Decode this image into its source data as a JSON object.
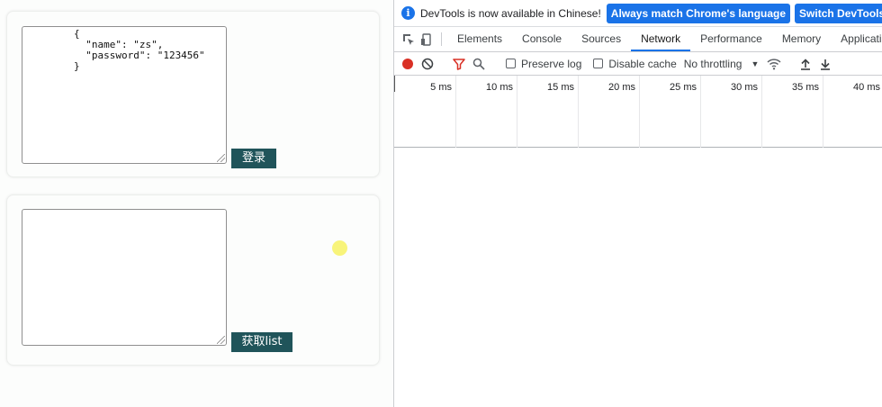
{
  "login_card": {
    "textarea_value": "        {\n          \"name\": \"zs\",\n          \"password\": \"123456\"\n        }",
    "button_label": "登录"
  },
  "list_card": {
    "textarea_value": "",
    "button_label": "获取list"
  },
  "devtools": {
    "infobar": {
      "message": "DevTools is now available in Chinese!",
      "match_language_button": "Always match Chrome's language",
      "switch_button": "Switch DevTools to Chinese"
    },
    "tabs": [
      {
        "label": "Elements"
      },
      {
        "label": "Console"
      },
      {
        "label": "Sources"
      },
      {
        "label": "Network",
        "active": true
      },
      {
        "label": "Performance"
      },
      {
        "label": "Memory"
      },
      {
        "label": "Application"
      }
    ],
    "network_toolbar": {
      "preserve_log_label": "Preserve log",
      "disable_cache_label": "Disable cache",
      "throttling_value": "No throttling"
    },
    "timeline_ticks": [
      "5 ms",
      "10 ms",
      "15 ms",
      "20 ms",
      "25 ms",
      "30 ms",
      "35 ms",
      "40 ms"
    ]
  },
  "colors": {
    "button_bg": "#20545a",
    "devtools_accent": "#1a73e8",
    "record_red": "#d93025"
  }
}
